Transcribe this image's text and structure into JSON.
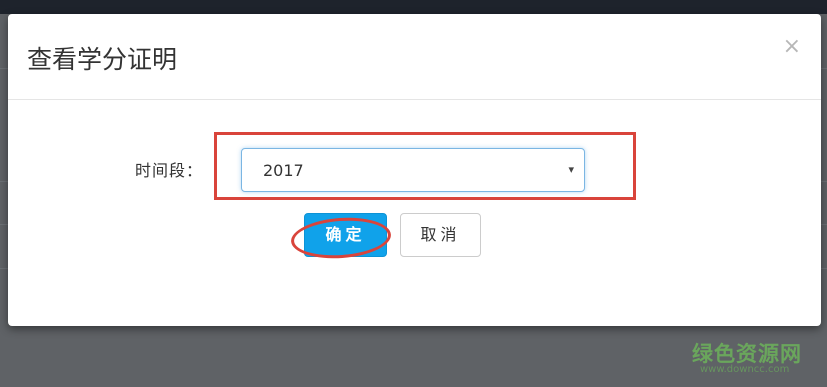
{
  "dialog": {
    "title": "查看学分证明",
    "close_symbol": "×",
    "field_label": "时间段：",
    "select": {
      "selected": "2017",
      "arrow": "▾"
    },
    "confirm_label": "确定",
    "cancel_label": "取消"
  },
  "annotations": {
    "color": "#d9443b"
  },
  "watermark": {
    "text": "绿色资源网",
    "url": "www.downcc.com"
  },
  "colors": {
    "primary": "#10a2ea",
    "backdrop": "#5f6266",
    "topbar": "#1e232c"
  }
}
